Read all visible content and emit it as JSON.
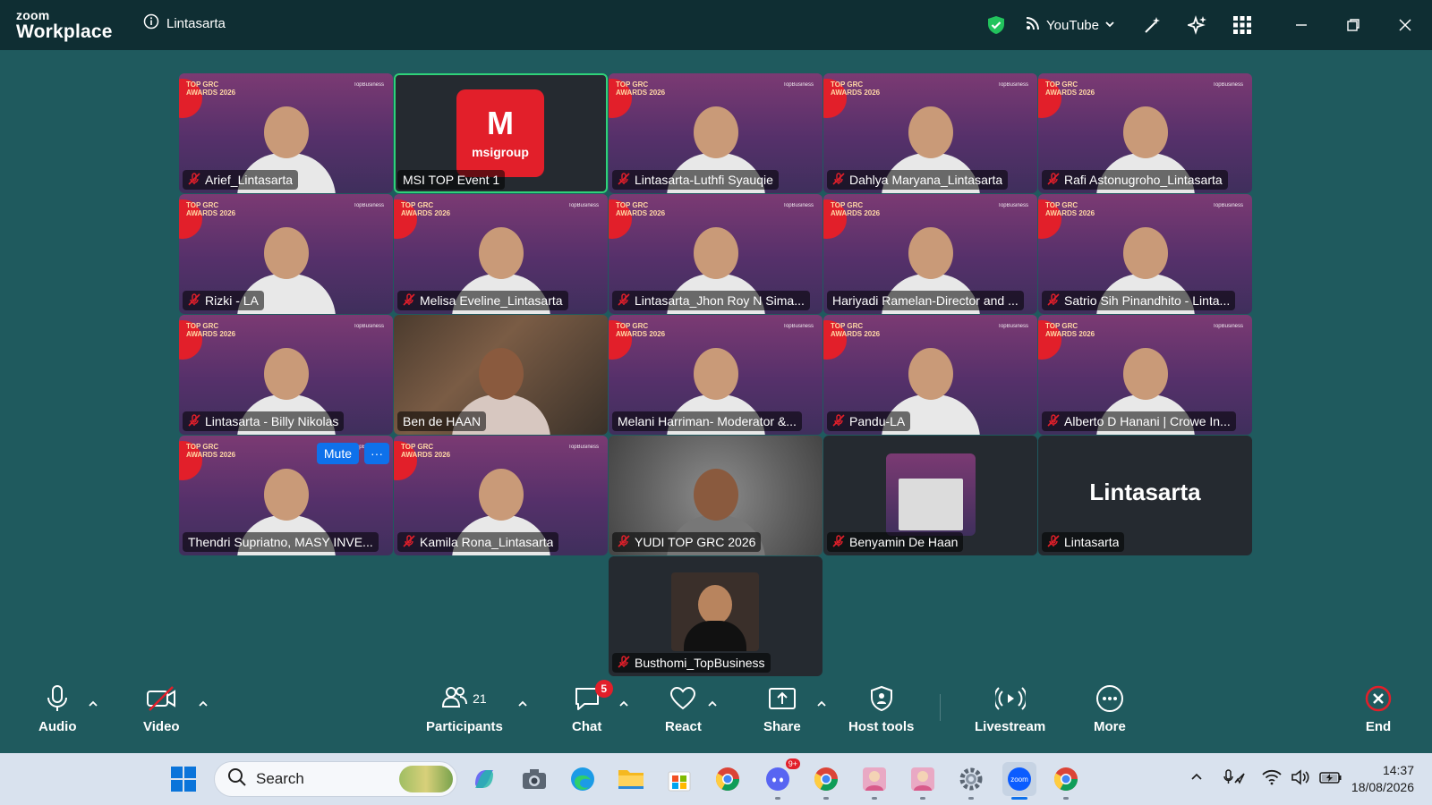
{
  "titlebar": {
    "logo_line1": "zoom",
    "logo_line2": "Workplace",
    "meeting_name": "Lintasarta",
    "livestream_target": "YouTube"
  },
  "tiles": [
    {
      "name": "Arief_Lintasarta",
      "muted": true,
      "bg": "grc"
    },
    {
      "name": "MSI TOP Event 1",
      "muted": false,
      "bg": "dark",
      "speaking": true,
      "logo_text": "msigroup"
    },
    {
      "name": "Lintasarta-Luthfi Syauqie",
      "muted": true,
      "bg": "grc"
    },
    {
      "name": "Dahlya Maryana_Lintasarta",
      "muted": true,
      "bg": "grc"
    },
    {
      "name": "Rafi Astonugroho_Lintasarta",
      "muted": true,
      "bg": "grc"
    },
    {
      "name": "Rizki - LA",
      "muted": true,
      "bg": "grc"
    },
    {
      "name": "Melisa Eveline_Lintasarta",
      "muted": true,
      "bg": "grc"
    },
    {
      "name": "Lintasarta_Jhon Roy N Sima...",
      "muted": true,
      "bg": "grc"
    },
    {
      "name": "Hariyadi Ramelan-Director and ...",
      "muted": false,
      "bg": "grc"
    },
    {
      "name": "Satrio Sih Pinandhito - Linta...",
      "muted": true,
      "bg": "grc"
    },
    {
      "name": "Lintasarta - Billy Nikolas",
      "muted": true,
      "bg": "grc"
    },
    {
      "name": "Ben de HAAN",
      "muted": false,
      "bg": "room"
    },
    {
      "name": "Melani Harriman- Moderator &...",
      "muted": false,
      "bg": "grc"
    },
    {
      "name": "Pandu-LA",
      "muted": true,
      "bg": "grc"
    },
    {
      "name": "Alberto D Hanani | Crowe In...",
      "muted": true,
      "bg": "grc"
    },
    {
      "name": "Thendri Supriatno, MASY INVE...",
      "muted": false,
      "bg": "grc",
      "hover": true
    },
    {
      "name": "Kamila Rona_Lintasarta",
      "muted": true,
      "bg": "grc"
    },
    {
      "name": "YUDI TOP GRC 2026",
      "muted": true,
      "bg": "blur"
    },
    {
      "name": "Benyamin De Haan",
      "muted": true,
      "bg": "dark",
      "thumb": true
    },
    {
      "name": "Lintasarta",
      "muted": true,
      "bg": "dark",
      "big_name": "Lintasarta"
    },
    {
      "name": "Busthomi_TopBusiness",
      "muted": true,
      "bg": "dark",
      "small_photo": true
    }
  ],
  "tile_overlay": {
    "badge_line1": "TOP GRC",
    "badge_line2": "AWARDS 2026",
    "brand": "TopBusiness",
    "mute_label": "Mute",
    "more_label": "···"
  },
  "toolbar": {
    "audio": "Audio",
    "video": "Video",
    "participants": "Participants",
    "participants_count": "21",
    "chat": "Chat",
    "chat_badge": "5",
    "react": "React",
    "share": "Share",
    "host_tools": "Host tools",
    "livestream": "Livestream",
    "more": "More",
    "end": "End"
  },
  "taskbar": {
    "search_placeholder": "Search",
    "discord_badge": "9+",
    "time": "14:37",
    "date": "18/08/2026"
  },
  "colors": {
    "accent_blue": "#0e71eb",
    "speaking_green": "#2fd27a",
    "mute_red": "#e21f2a",
    "background": "#1f5a5e"
  }
}
